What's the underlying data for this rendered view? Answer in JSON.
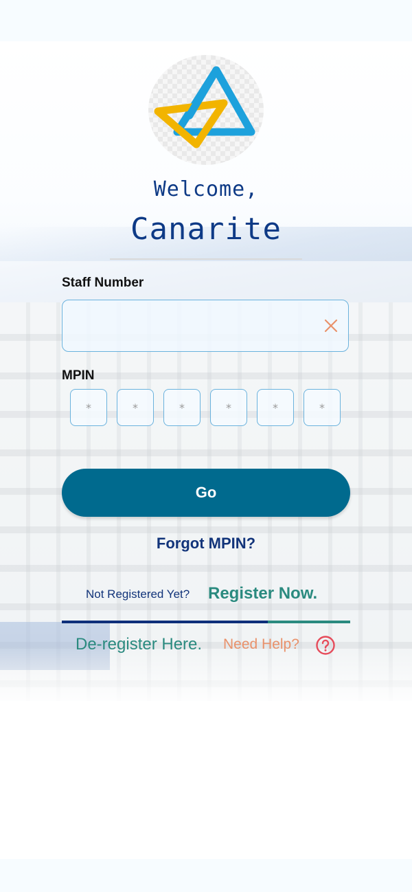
{
  "header": {
    "welcome_text": "Welcome,",
    "user_name": "Canarite"
  },
  "form": {
    "staff_label": "Staff Number",
    "staff_value": "",
    "mpin_label": "MPIN",
    "mpin_digits": [
      "*",
      "*",
      "*",
      "*",
      "*",
      "*"
    ],
    "go_label": "Go"
  },
  "links": {
    "forgot_mpin": "Forgot MPIN?",
    "not_registered": "Not Registered Yet?",
    "register_now": "Register Now.",
    "deregister": "De-register Here.",
    "need_help": "Need Help?"
  },
  "icons": {
    "logo": "canara-bank-logo",
    "clear": "close-icon",
    "help": "question-circle-icon"
  },
  "colors": {
    "primary": "#006a8e",
    "navy": "#0e3a86",
    "teal": "#2a8a7f",
    "coral": "#e9916a",
    "field_border": "#6ab2dd"
  }
}
